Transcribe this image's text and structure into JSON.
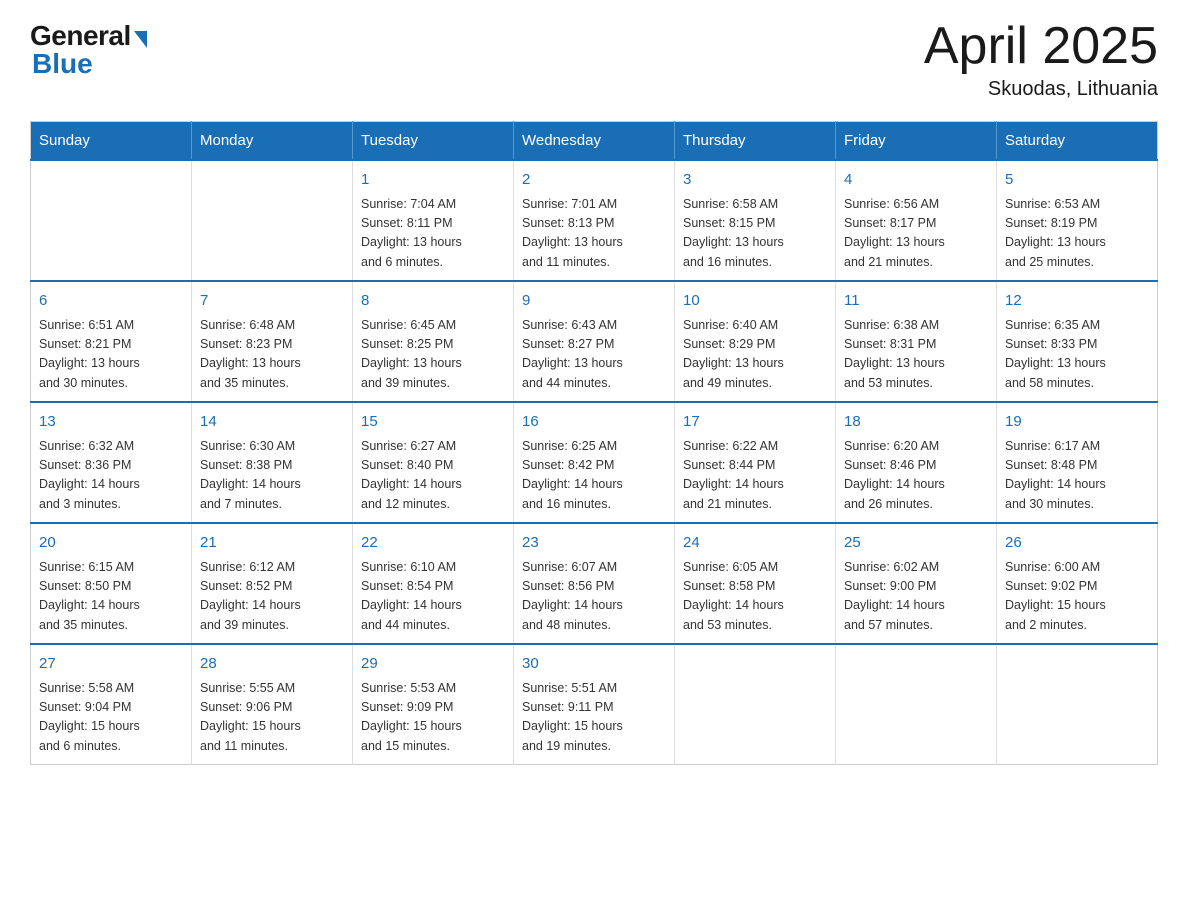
{
  "logo": {
    "general": "General",
    "blue": "Blue"
  },
  "header": {
    "month": "April 2025",
    "location": "Skuodas, Lithuania"
  },
  "weekdays": [
    "Sunday",
    "Monday",
    "Tuesday",
    "Wednesday",
    "Thursday",
    "Friday",
    "Saturday"
  ],
  "weeks": [
    [
      {
        "day": "",
        "info": ""
      },
      {
        "day": "",
        "info": ""
      },
      {
        "day": "1",
        "info": "Sunrise: 7:04 AM\nSunset: 8:11 PM\nDaylight: 13 hours\nand 6 minutes."
      },
      {
        "day": "2",
        "info": "Sunrise: 7:01 AM\nSunset: 8:13 PM\nDaylight: 13 hours\nand 11 minutes."
      },
      {
        "day": "3",
        "info": "Sunrise: 6:58 AM\nSunset: 8:15 PM\nDaylight: 13 hours\nand 16 minutes."
      },
      {
        "day": "4",
        "info": "Sunrise: 6:56 AM\nSunset: 8:17 PM\nDaylight: 13 hours\nand 21 minutes."
      },
      {
        "day": "5",
        "info": "Sunrise: 6:53 AM\nSunset: 8:19 PM\nDaylight: 13 hours\nand 25 minutes."
      }
    ],
    [
      {
        "day": "6",
        "info": "Sunrise: 6:51 AM\nSunset: 8:21 PM\nDaylight: 13 hours\nand 30 minutes."
      },
      {
        "day": "7",
        "info": "Sunrise: 6:48 AM\nSunset: 8:23 PM\nDaylight: 13 hours\nand 35 minutes."
      },
      {
        "day": "8",
        "info": "Sunrise: 6:45 AM\nSunset: 8:25 PM\nDaylight: 13 hours\nand 39 minutes."
      },
      {
        "day": "9",
        "info": "Sunrise: 6:43 AM\nSunset: 8:27 PM\nDaylight: 13 hours\nand 44 minutes."
      },
      {
        "day": "10",
        "info": "Sunrise: 6:40 AM\nSunset: 8:29 PM\nDaylight: 13 hours\nand 49 minutes."
      },
      {
        "day": "11",
        "info": "Sunrise: 6:38 AM\nSunset: 8:31 PM\nDaylight: 13 hours\nand 53 minutes."
      },
      {
        "day": "12",
        "info": "Sunrise: 6:35 AM\nSunset: 8:33 PM\nDaylight: 13 hours\nand 58 minutes."
      }
    ],
    [
      {
        "day": "13",
        "info": "Sunrise: 6:32 AM\nSunset: 8:36 PM\nDaylight: 14 hours\nand 3 minutes."
      },
      {
        "day": "14",
        "info": "Sunrise: 6:30 AM\nSunset: 8:38 PM\nDaylight: 14 hours\nand 7 minutes."
      },
      {
        "day": "15",
        "info": "Sunrise: 6:27 AM\nSunset: 8:40 PM\nDaylight: 14 hours\nand 12 minutes."
      },
      {
        "day": "16",
        "info": "Sunrise: 6:25 AM\nSunset: 8:42 PM\nDaylight: 14 hours\nand 16 minutes."
      },
      {
        "day": "17",
        "info": "Sunrise: 6:22 AM\nSunset: 8:44 PM\nDaylight: 14 hours\nand 21 minutes."
      },
      {
        "day": "18",
        "info": "Sunrise: 6:20 AM\nSunset: 8:46 PM\nDaylight: 14 hours\nand 26 minutes."
      },
      {
        "day": "19",
        "info": "Sunrise: 6:17 AM\nSunset: 8:48 PM\nDaylight: 14 hours\nand 30 minutes."
      }
    ],
    [
      {
        "day": "20",
        "info": "Sunrise: 6:15 AM\nSunset: 8:50 PM\nDaylight: 14 hours\nand 35 minutes."
      },
      {
        "day": "21",
        "info": "Sunrise: 6:12 AM\nSunset: 8:52 PM\nDaylight: 14 hours\nand 39 minutes."
      },
      {
        "day": "22",
        "info": "Sunrise: 6:10 AM\nSunset: 8:54 PM\nDaylight: 14 hours\nand 44 minutes."
      },
      {
        "day": "23",
        "info": "Sunrise: 6:07 AM\nSunset: 8:56 PM\nDaylight: 14 hours\nand 48 minutes."
      },
      {
        "day": "24",
        "info": "Sunrise: 6:05 AM\nSunset: 8:58 PM\nDaylight: 14 hours\nand 53 minutes."
      },
      {
        "day": "25",
        "info": "Sunrise: 6:02 AM\nSunset: 9:00 PM\nDaylight: 14 hours\nand 57 minutes."
      },
      {
        "day": "26",
        "info": "Sunrise: 6:00 AM\nSunset: 9:02 PM\nDaylight: 15 hours\nand 2 minutes."
      }
    ],
    [
      {
        "day": "27",
        "info": "Sunrise: 5:58 AM\nSunset: 9:04 PM\nDaylight: 15 hours\nand 6 minutes."
      },
      {
        "day": "28",
        "info": "Sunrise: 5:55 AM\nSunset: 9:06 PM\nDaylight: 15 hours\nand 11 minutes."
      },
      {
        "day": "29",
        "info": "Sunrise: 5:53 AM\nSunset: 9:09 PM\nDaylight: 15 hours\nand 15 minutes."
      },
      {
        "day": "30",
        "info": "Sunrise: 5:51 AM\nSunset: 9:11 PM\nDaylight: 15 hours\nand 19 minutes."
      },
      {
        "day": "",
        "info": ""
      },
      {
        "day": "",
        "info": ""
      },
      {
        "day": "",
        "info": ""
      }
    ]
  ]
}
